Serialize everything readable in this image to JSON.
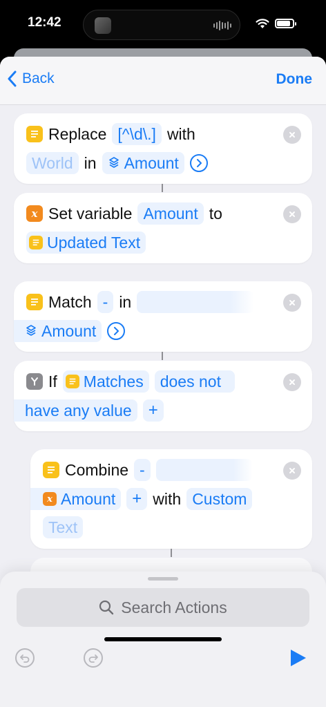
{
  "status": {
    "time": "12:42",
    "battery_level": 0.85
  },
  "nav": {
    "back_label": "Back",
    "done_label": "Done"
  },
  "actions": {
    "replace": {
      "verb": "Replace",
      "pattern": "[^\\d\\.]",
      "with_word": "with",
      "replacement": "World",
      "in_word": "in",
      "target": "Amount"
    },
    "set_variable": {
      "verb": "Set variable",
      "variable": "Amount",
      "to_word": "to",
      "value": "Updated Text"
    },
    "match": {
      "verb": "Match",
      "pattern": "-",
      "in_word": "in",
      "target": "Amount"
    },
    "if": {
      "verb": "If",
      "input": "Matches",
      "condition_line1": "does not",
      "condition_line2": "have any value"
    },
    "combine": {
      "verb": "Combine",
      "separator_value": "-",
      "list": "Amount",
      "with_word": "with",
      "custom_line1": "Custom",
      "custom_line2": "Text"
    }
  },
  "bottom": {
    "search_placeholder": "Search Actions"
  },
  "colors": {
    "accent": "#1a7cf5",
    "text_icon": "#f9c11b",
    "variable_icon": "#f28a1e",
    "if_icon": "#8a8a8e"
  },
  "icons": [
    "chevron-left-icon",
    "text-icon",
    "variable-icon",
    "if-icon",
    "magic-variable-icon",
    "chevron-right-circle-icon",
    "close-icon",
    "plus-icon",
    "search-icon",
    "undo-icon",
    "redo-icon",
    "play-icon",
    "wifi-icon",
    "battery-icon"
  ]
}
